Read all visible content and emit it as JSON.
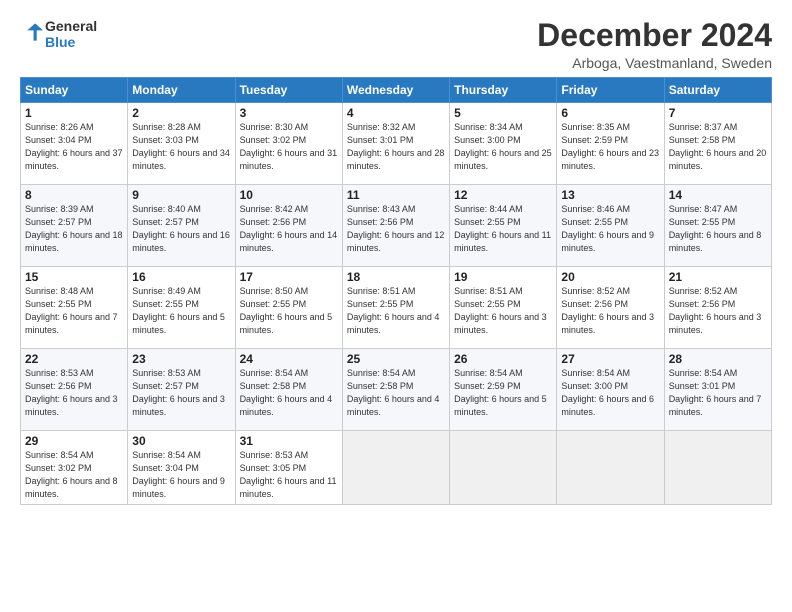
{
  "header": {
    "logo_line1": "General",
    "logo_line2": "Blue",
    "month": "December 2024",
    "location": "Arboga, Vaestmanland, Sweden"
  },
  "weekdays": [
    "Sunday",
    "Monday",
    "Tuesday",
    "Wednesday",
    "Thursday",
    "Friday",
    "Saturday"
  ],
  "weeks": [
    [
      {
        "day": "1",
        "sunrise": "Sunrise: 8:26 AM",
        "sunset": "Sunset: 3:04 PM",
        "daylight": "Daylight: 6 hours and 37 minutes."
      },
      {
        "day": "2",
        "sunrise": "Sunrise: 8:28 AM",
        "sunset": "Sunset: 3:03 PM",
        "daylight": "Daylight: 6 hours and 34 minutes."
      },
      {
        "day": "3",
        "sunrise": "Sunrise: 8:30 AM",
        "sunset": "Sunset: 3:02 PM",
        "daylight": "Daylight: 6 hours and 31 minutes."
      },
      {
        "day": "4",
        "sunrise": "Sunrise: 8:32 AM",
        "sunset": "Sunset: 3:01 PM",
        "daylight": "Daylight: 6 hours and 28 minutes."
      },
      {
        "day": "5",
        "sunrise": "Sunrise: 8:34 AM",
        "sunset": "Sunset: 3:00 PM",
        "daylight": "Daylight: 6 hours and 25 minutes."
      },
      {
        "day": "6",
        "sunrise": "Sunrise: 8:35 AM",
        "sunset": "Sunset: 2:59 PM",
        "daylight": "Daylight: 6 hours and 23 minutes."
      },
      {
        "day": "7",
        "sunrise": "Sunrise: 8:37 AM",
        "sunset": "Sunset: 2:58 PM",
        "daylight": "Daylight: 6 hours and 20 minutes."
      }
    ],
    [
      {
        "day": "8",
        "sunrise": "Sunrise: 8:39 AM",
        "sunset": "Sunset: 2:57 PM",
        "daylight": "Daylight: 6 hours and 18 minutes."
      },
      {
        "day": "9",
        "sunrise": "Sunrise: 8:40 AM",
        "sunset": "Sunset: 2:57 PM",
        "daylight": "Daylight: 6 hours and 16 minutes."
      },
      {
        "day": "10",
        "sunrise": "Sunrise: 8:42 AM",
        "sunset": "Sunset: 2:56 PM",
        "daylight": "Daylight: 6 hours and 14 minutes."
      },
      {
        "day": "11",
        "sunrise": "Sunrise: 8:43 AM",
        "sunset": "Sunset: 2:56 PM",
        "daylight": "Daylight: 6 hours and 12 minutes."
      },
      {
        "day": "12",
        "sunrise": "Sunrise: 8:44 AM",
        "sunset": "Sunset: 2:55 PM",
        "daylight": "Daylight: 6 hours and 11 minutes."
      },
      {
        "day": "13",
        "sunrise": "Sunrise: 8:46 AM",
        "sunset": "Sunset: 2:55 PM",
        "daylight": "Daylight: 6 hours and 9 minutes."
      },
      {
        "day": "14",
        "sunrise": "Sunrise: 8:47 AM",
        "sunset": "Sunset: 2:55 PM",
        "daylight": "Daylight: 6 hours and 8 minutes."
      }
    ],
    [
      {
        "day": "15",
        "sunrise": "Sunrise: 8:48 AM",
        "sunset": "Sunset: 2:55 PM",
        "daylight": "Daylight: 6 hours and 7 minutes."
      },
      {
        "day": "16",
        "sunrise": "Sunrise: 8:49 AM",
        "sunset": "Sunset: 2:55 PM",
        "daylight": "Daylight: 6 hours and 5 minutes."
      },
      {
        "day": "17",
        "sunrise": "Sunrise: 8:50 AM",
        "sunset": "Sunset: 2:55 PM",
        "daylight": "Daylight: 6 hours and 5 minutes."
      },
      {
        "day": "18",
        "sunrise": "Sunrise: 8:51 AM",
        "sunset": "Sunset: 2:55 PM",
        "daylight": "Daylight: 6 hours and 4 minutes."
      },
      {
        "day": "19",
        "sunrise": "Sunrise: 8:51 AM",
        "sunset": "Sunset: 2:55 PM",
        "daylight": "Daylight: 6 hours and 3 minutes."
      },
      {
        "day": "20",
        "sunrise": "Sunrise: 8:52 AM",
        "sunset": "Sunset: 2:56 PM",
        "daylight": "Daylight: 6 hours and 3 minutes."
      },
      {
        "day": "21",
        "sunrise": "Sunrise: 8:52 AM",
        "sunset": "Sunset: 2:56 PM",
        "daylight": "Daylight: 6 hours and 3 minutes."
      }
    ],
    [
      {
        "day": "22",
        "sunrise": "Sunrise: 8:53 AM",
        "sunset": "Sunset: 2:56 PM",
        "daylight": "Daylight: 6 hours and 3 minutes."
      },
      {
        "day": "23",
        "sunrise": "Sunrise: 8:53 AM",
        "sunset": "Sunset: 2:57 PM",
        "daylight": "Daylight: 6 hours and 3 minutes."
      },
      {
        "day": "24",
        "sunrise": "Sunrise: 8:54 AM",
        "sunset": "Sunset: 2:58 PM",
        "daylight": "Daylight: 6 hours and 4 minutes."
      },
      {
        "day": "25",
        "sunrise": "Sunrise: 8:54 AM",
        "sunset": "Sunset: 2:58 PM",
        "daylight": "Daylight: 6 hours and 4 minutes."
      },
      {
        "day": "26",
        "sunrise": "Sunrise: 8:54 AM",
        "sunset": "Sunset: 2:59 PM",
        "daylight": "Daylight: 6 hours and 5 minutes."
      },
      {
        "day": "27",
        "sunrise": "Sunrise: 8:54 AM",
        "sunset": "Sunset: 3:00 PM",
        "daylight": "Daylight: 6 hours and 6 minutes."
      },
      {
        "day": "28",
        "sunrise": "Sunrise: 8:54 AM",
        "sunset": "Sunset: 3:01 PM",
        "daylight": "Daylight: 6 hours and 7 minutes."
      }
    ],
    [
      {
        "day": "29",
        "sunrise": "Sunrise: 8:54 AM",
        "sunset": "Sunset: 3:02 PM",
        "daylight": "Daylight: 6 hours and 8 minutes."
      },
      {
        "day": "30",
        "sunrise": "Sunrise: 8:54 AM",
        "sunset": "Sunset: 3:04 PM",
        "daylight": "Daylight: 6 hours and 9 minutes."
      },
      {
        "day": "31",
        "sunrise": "Sunrise: 8:53 AM",
        "sunset": "Sunset: 3:05 PM",
        "daylight": "Daylight: 6 hours and 11 minutes."
      },
      null,
      null,
      null,
      null
    ]
  ]
}
